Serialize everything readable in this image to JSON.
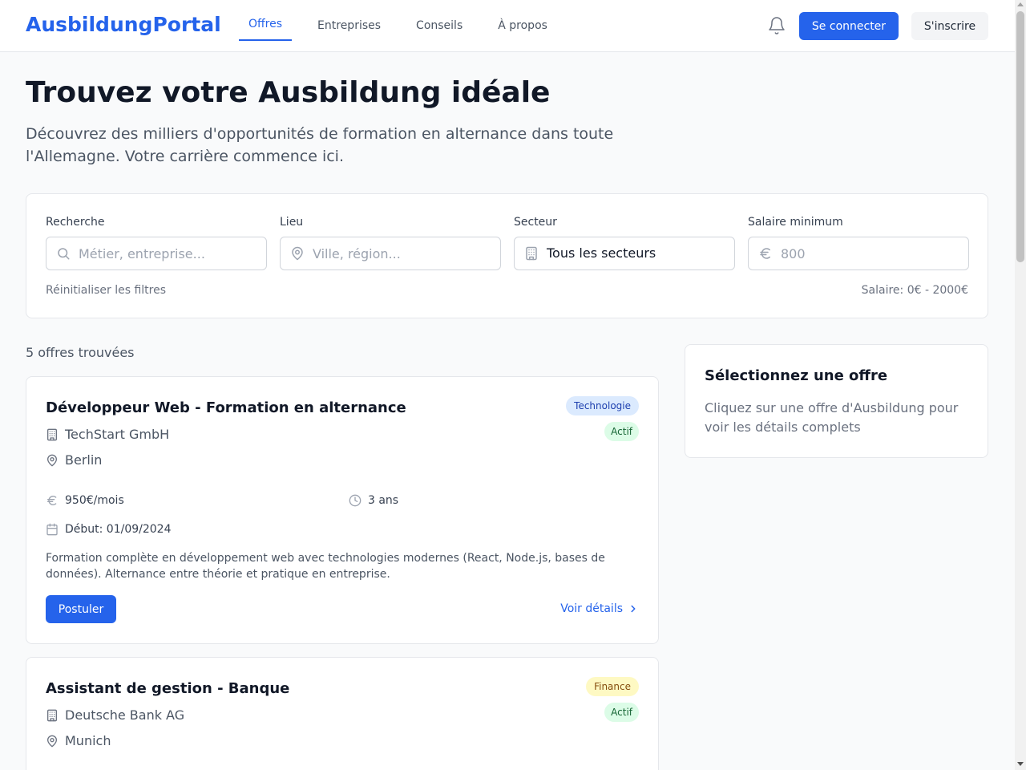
{
  "header": {
    "logo": "AusbildungPortal",
    "nav": [
      {
        "label": "Offres",
        "active": true
      },
      {
        "label": "Entreprises",
        "active": false
      },
      {
        "label": "Conseils",
        "active": false
      },
      {
        "label": "À propos",
        "active": false
      }
    ],
    "login_label": "Se connecter",
    "signup_label": "S'inscrire"
  },
  "hero": {
    "title": "Trouvez votre Ausbildung idéale",
    "subtitle": "Découvrez des milliers d'opportunités de formation en alternance dans toute l'Allemagne. Votre carrière commence ici."
  },
  "filters": {
    "search": {
      "label": "Recherche",
      "placeholder": "Métier, entreprise...",
      "icon": "search-icon"
    },
    "location": {
      "label": "Lieu",
      "placeholder": "Ville, région...",
      "icon": "map-pin-icon"
    },
    "sector": {
      "label": "Secteur",
      "value": "Tous les secteurs",
      "icon": "building-icon"
    },
    "salary": {
      "label": "Salaire minimum",
      "placeholder": "800",
      "icon": "euro-icon"
    },
    "reset_label": "Réinitialiser les filtres",
    "salary_range": "Salaire: 0€ - 2000€"
  },
  "results": {
    "count": "5 offres trouvées",
    "offers": [
      {
        "title": "Développeur Web - Formation en alternance",
        "company": "TechStart GmbH",
        "city": "Berlin",
        "sector": "Technologie",
        "sector_bg": "#dbeafe",
        "sector_color": "#1e40af",
        "status": "Actif",
        "salary": "950€/mois",
        "duration": "3 ans",
        "start": "Début: 01/09/2024",
        "description": "Formation complète en développement web avec technologies modernes (React, Node.js, bases de données). Alternance entre théorie et pratique en entreprise.",
        "apply_label": "Postuler",
        "details_label": "Voir détails"
      },
      {
        "title": "Assistant de gestion - Banque",
        "company": "Deutsche Bank AG",
        "city": "Munich",
        "sector": "Finance",
        "sector_bg": "#fef9c3",
        "sector_color": "#854d0e",
        "status": "Actif"
      }
    ]
  },
  "detail_panel": {
    "title": "Sélectionnez une offre",
    "text": "Cliquez sur une offre d'Ausbildung pour voir les détails complets"
  },
  "colors": {
    "primary": "#2563eb",
    "status_bg": "#dcfce7",
    "status_text": "#166534"
  }
}
